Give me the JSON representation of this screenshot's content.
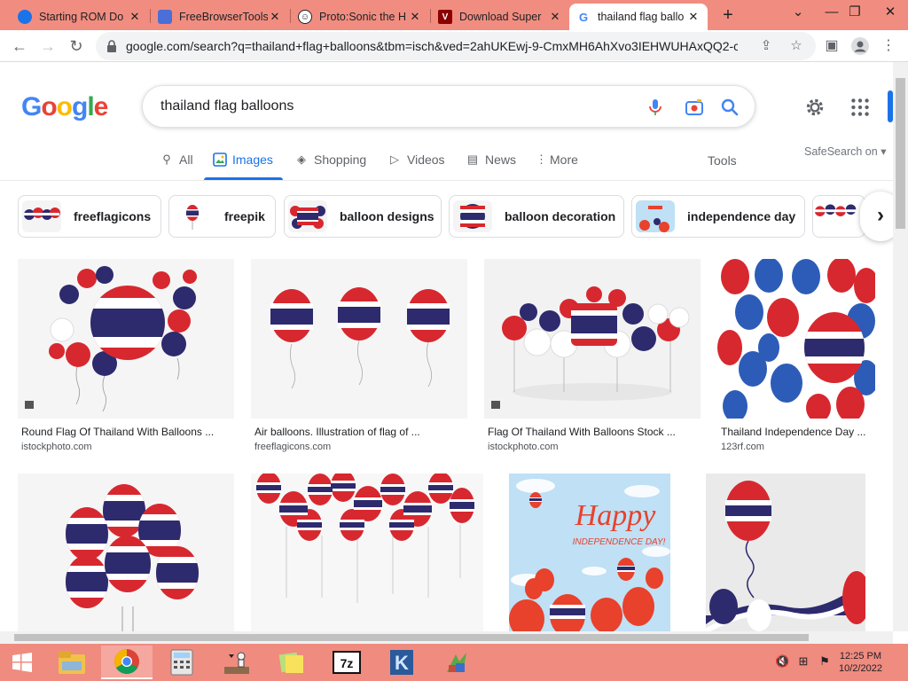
{
  "browser": {
    "tabs": [
      {
        "title": "Starting ROM Do",
        "favicon": "chrome-icon"
      },
      {
        "title": "FreeBrowserTools",
        "favicon": "shield-icon"
      },
      {
        "title": "Proto:Sonic the H",
        "favicon": "smiley-icon"
      },
      {
        "title": "Download Super",
        "favicon": "v-logo-icon"
      },
      {
        "title": "thailand flag ballo",
        "favicon": "google-g-icon"
      }
    ],
    "url": "google.com/search?q=thailand+flag+balloons&tbm=isch&ved=2ahUKEwj-9-CmxMH6AhXvo3IEHWUHAxQQ2-c..."
  },
  "google": {
    "logo": "Google",
    "query": "thailand flag balloons",
    "nav_tabs": [
      {
        "label": "All",
        "icon": "search-icon"
      },
      {
        "label": "Images",
        "icon": "image-icon",
        "active": true
      },
      {
        "label": "Shopping",
        "icon": "tag-icon"
      },
      {
        "label": "Videos",
        "icon": "play-icon"
      },
      {
        "label": "News",
        "icon": "newspaper-icon"
      },
      {
        "label": "More",
        "icon": "more-vert-icon"
      }
    ],
    "tools": "Tools",
    "safesearch": "SafeSearch on",
    "chips": [
      {
        "label": "freeflagicons"
      },
      {
        "label": "freepik"
      },
      {
        "label": "balloon designs"
      },
      {
        "label": "balloon decoration"
      },
      {
        "label": "independence day"
      }
    ]
  },
  "results": [
    {
      "caption": "Round Flag Of Thailand With Balloons ...",
      "source": "istockphoto.com"
    },
    {
      "caption": "Air balloons. Illustration of flag of ...",
      "source": "freeflagicons.com"
    },
    {
      "caption": "Flag Of Thailand With Balloons Stock ...",
      "source": "istockphoto.com"
    },
    {
      "caption": "Thailand Independence Day ...",
      "source": "123rf.com"
    }
  ],
  "result_row2": {
    "happy_text": "Happy",
    "independence_text": "INDEPENDENCE DAY!"
  },
  "taskbar": {
    "time": "12:25 PM",
    "date": "10/2/2022",
    "apps": [
      "file-explorer-icon",
      "chrome-icon",
      "calculator-icon",
      "chess-icon",
      "sticky-notes-icon",
      "7zip-icon",
      "k-app-icon",
      "winrar-icon"
    ]
  },
  "colors": {
    "accent": "#1a73e8",
    "tabstrip": "#f18d80",
    "taskbar": "#f08b80",
    "flag_red": "#d7282f",
    "flag_blue": "#2d2a6e"
  }
}
